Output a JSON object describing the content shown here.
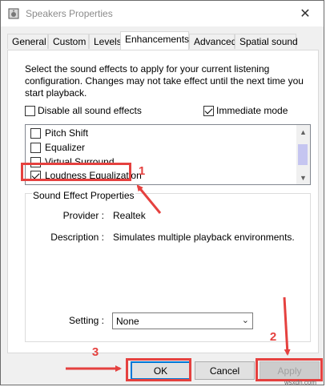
{
  "window": {
    "title": "Speakers Properties",
    "close_symbol": "✕"
  },
  "tabs": [
    {
      "label": "General",
      "active": false
    },
    {
      "label": "Custom",
      "active": false
    },
    {
      "label": "Levels",
      "active": false
    },
    {
      "label": "Enhancements",
      "active": true
    },
    {
      "label": "Advanced",
      "active": false
    },
    {
      "label": "Spatial sound",
      "active": false
    }
  ],
  "enhancements": {
    "intro_text": "Select the sound effects to apply for your current listening configuration. Changes may not take effect until the next time you start playback.",
    "disable_all_label": "Disable all sound effects",
    "disable_all_checked": false,
    "immediate_mode_label": "Immediate mode",
    "immediate_mode_checked": true,
    "effects": [
      {
        "label": "Pitch Shift",
        "checked": false
      },
      {
        "label": "Equalizer",
        "checked": false
      },
      {
        "label": "Virtual Surround",
        "checked": false
      },
      {
        "label": "Loudness Equalization",
        "checked": true
      }
    ],
    "properties": {
      "title": "Sound Effect Properties",
      "provider_label": "Provider :",
      "provider_value": "Realtek",
      "description_label": "Description :",
      "description_value": "Simulates multiple playback environments.",
      "setting_label": "Setting :",
      "setting_value": "None"
    }
  },
  "buttons": {
    "ok": "OK",
    "cancel": "Cancel",
    "apply": "Apply"
  },
  "annotations": {
    "step1": "1",
    "step2": "2",
    "step3": "3",
    "color": "#e5413f"
  },
  "watermark": "wsxdn.com"
}
